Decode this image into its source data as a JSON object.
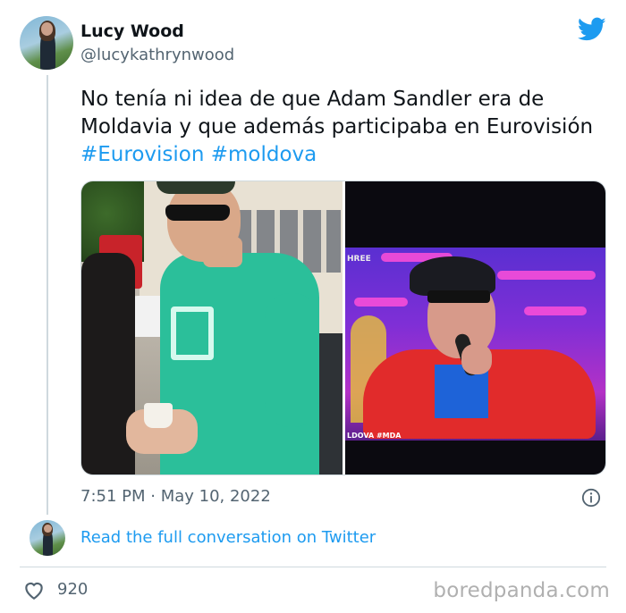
{
  "tweet": {
    "author": {
      "display_name": "Lucy Wood",
      "handle": "@lucykathrynwood"
    },
    "text_line1": "No tenía ni idea de que Adam Sandler era de",
    "text_line2": "Moldavia y que además participaba en Eurovisión",
    "hashtags": "#Eurovision #moldova",
    "timestamp": "7:51 PM · May 10, 2022",
    "media": {
      "left_photo_overlay": "",
      "right_photo_corner_text": "HREE",
      "right_photo_ticker": "LDOVA #MDA"
    },
    "read_conversation_label": "Read the full conversation on Twitter",
    "like_count": "920"
  },
  "watermark": "boredpanda.com",
  "icons": {
    "twitter_logo": "twitter-bird-icon",
    "info": "info-icon",
    "like": "heart-icon"
  },
  "colors": {
    "link_blue": "#1d9bf0",
    "text_primary": "#0f1419",
    "text_secondary": "#536471",
    "border": "#cfd9de"
  }
}
